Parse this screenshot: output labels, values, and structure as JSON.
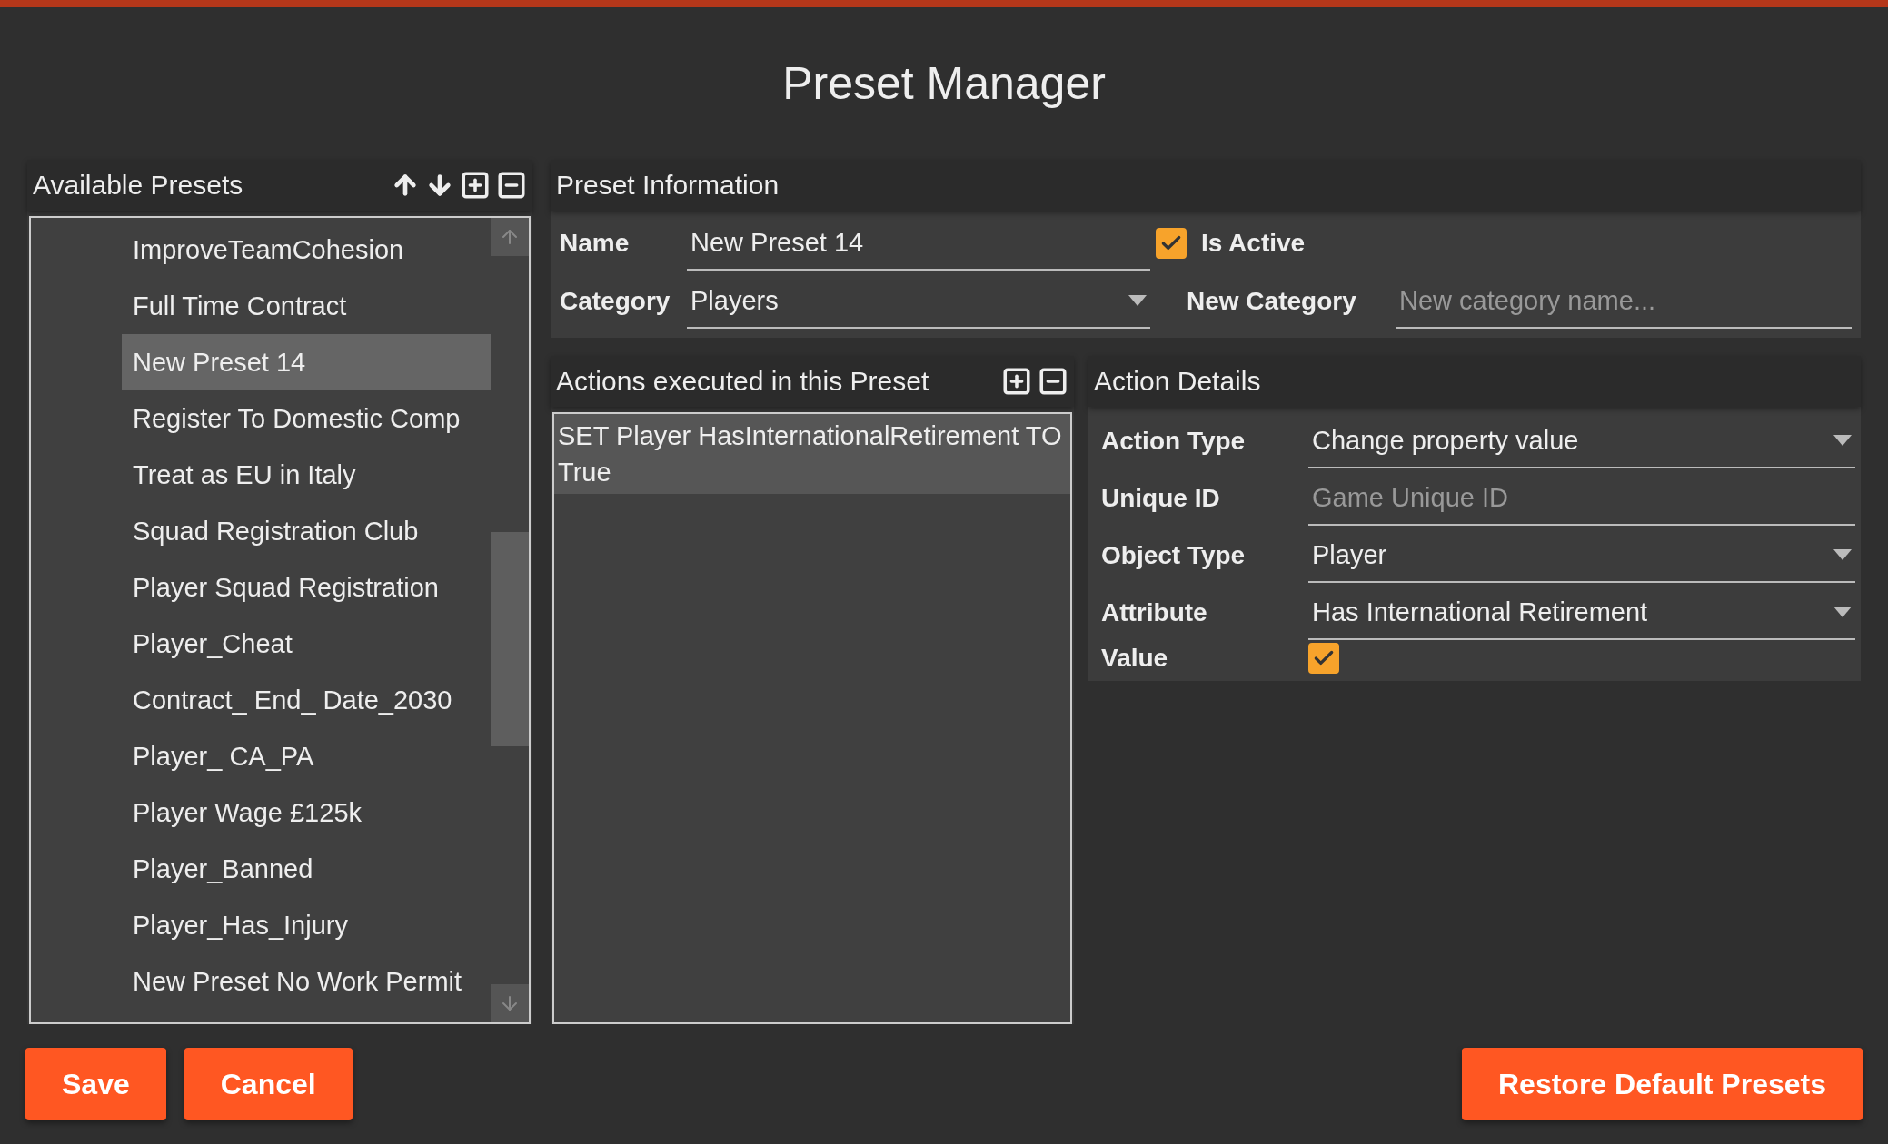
{
  "window": {
    "title": "Preset Manager"
  },
  "presets": {
    "title": "Available Presets",
    "items": [
      {
        "label": "ImproveTeamCohesion",
        "selected": false
      },
      {
        "label": "Full Time Contract",
        "selected": false
      },
      {
        "label": "New Preset 14",
        "selected": true
      },
      {
        "label": "Register To Domestic Comp",
        "selected": false
      },
      {
        "label": "Treat as EU in Italy",
        "selected": false
      },
      {
        "label": "Squad Registration Club",
        "selected": false
      },
      {
        "label": "Player Squad Registration",
        "selected": false
      },
      {
        "label": "Player_Cheat",
        "selected": false
      },
      {
        "label": "Contract_ End_ Date_2030",
        "selected": false
      },
      {
        "label": "Player_ CA_PA",
        "selected": false
      },
      {
        "label": "Player Wage £125k",
        "selected": false
      },
      {
        "label": "Player_Banned",
        "selected": false
      },
      {
        "label": "Player_Has_Injury",
        "selected": false
      },
      {
        "label": "New Preset No Work Permit",
        "selected": false
      }
    ]
  },
  "preset_information": {
    "title": "Preset Information",
    "name": {
      "label": "Name",
      "value": "New Preset 14"
    },
    "is_active": {
      "label": "Is Active",
      "checked": true
    },
    "category": {
      "label": "Category",
      "value": "Players"
    },
    "new_category": {
      "label": "New Category",
      "placeholder": "New category name..."
    }
  },
  "actions": {
    "title": "Actions executed in this Preset",
    "items": [
      {
        "text": "SET Player HasInternationalRetirement TO True",
        "selected": true
      }
    ]
  },
  "action_details": {
    "title": "Action Details",
    "fields": [
      {
        "kind": "dropdown",
        "label": "Action Type",
        "value": "Change property value"
      },
      {
        "kind": "text",
        "label": "Unique ID",
        "placeholder": "Game Unique ID"
      },
      {
        "kind": "dropdown",
        "label": "Object Type",
        "value": "Player"
      },
      {
        "kind": "dropdown",
        "label": "Attribute",
        "value": "Has International Retirement"
      },
      {
        "kind": "checkbox",
        "label": "Value",
        "checked": true
      }
    ]
  },
  "buttons": [
    {
      "label": "Save"
    },
    {
      "label": "Cancel"
    }
  ],
  "restore_button": {
    "label": "Restore Default Presets"
  }
}
